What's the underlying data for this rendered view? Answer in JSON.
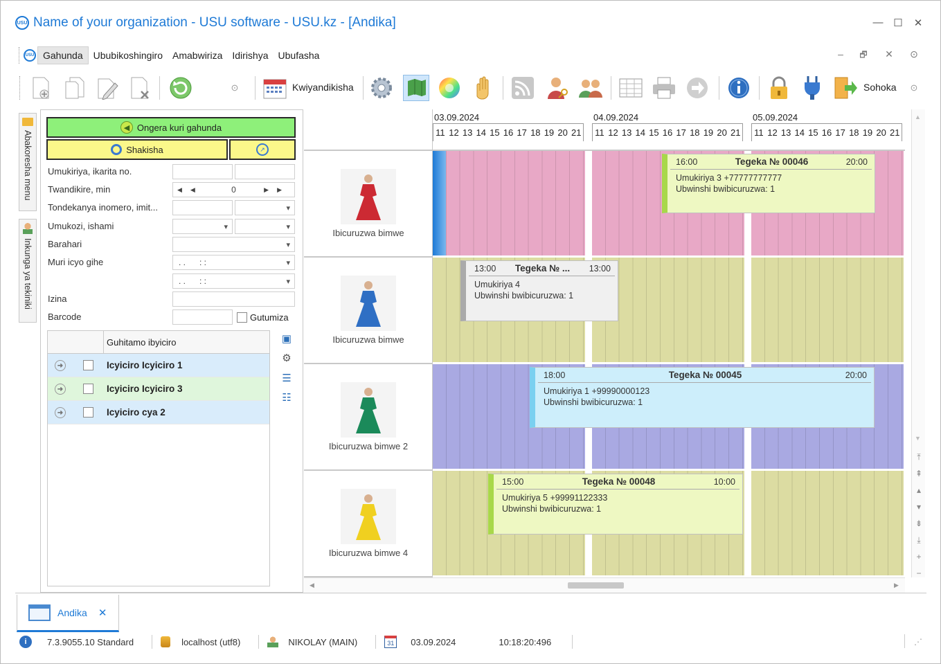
{
  "window": {
    "title": "Name of your organization - USU software - USU.kz - [Andika]",
    "logo_text": "USU",
    "controls": {
      "minimize": "—",
      "maximize": "☐",
      "close": "✕"
    }
  },
  "menu": {
    "items": [
      "Gahunda",
      "Ububikoshingiro",
      "Amabwiriza",
      "Idirishya",
      "Ubufasha"
    ],
    "active_index": 0,
    "mdi_controls": {
      "minimize": "–",
      "restore": "🗗",
      "close": "✕",
      "more": "⊙"
    }
  },
  "toolbar": {
    "kwiyandikisha_label": "Kwiyandikisha",
    "sohoka_label": "Sohoka",
    "icons": [
      "new-doc-icon",
      "copy-icon",
      "edit-icon",
      "delete-icon",
      "refresh-icon",
      "more-icon",
      "calendar-icon",
      "settings-icon",
      "map-icon",
      "color-wheel-icon",
      "hand-icon",
      "rss-icon",
      "user-key-icon",
      "users-icon",
      "grid-icon",
      "print-icon",
      "forward-icon",
      "info-icon",
      "lock-icon",
      "plug-icon",
      "exit-icon"
    ]
  },
  "sidetabs": [
    "Abakoresha menu",
    "Inkunga ya tekiniki"
  ],
  "leftpanel": {
    "add_button": "Ongera kuri gahunda",
    "search_button": "Shakisha",
    "fields": {
      "client_label": "Umukiriya, ikarita no.",
      "duration_label": "Twandikire, min",
      "duration_value": "0",
      "order_label": "Tondekanya inomero, imit...",
      "employee_label": "Umukozi, ishami",
      "email_label": "Barahari",
      "time_label": "Muri icyo gihe",
      "datetime_placeholder": ". .      : :",
      "name_label": "Izina",
      "barcode_label": "Barcode",
      "lock_label": "Gutumiza"
    },
    "tree": {
      "header": "Guhitamo ibyiciro",
      "rows": [
        "Icyiciro Icyiciro 1",
        "Icyiciro Icyiciro 3",
        "Icyiciro cya 2"
      ]
    }
  },
  "schedule": {
    "dates": [
      "03.09.2024",
      "04.09.2024",
      "05.09.2024"
    ],
    "hours": [
      "11",
      "12",
      "13",
      "14",
      "15",
      "16",
      "17",
      "18",
      "19",
      "20",
      "21"
    ],
    "resources": [
      {
        "label": "Ibicuruzwa bimwe",
        "color": "#e8a8c6"
      },
      {
        "label": "Ibicuruzwa bimwe",
        "color": "#dcdca2"
      },
      {
        "label": "Ibicuruzwa bimwe 2",
        "color": "#a9a9e2"
      },
      {
        "label": "Ibicuruzwa bimwe 4",
        "color": "#dcdca2"
      }
    ],
    "bookings": [
      {
        "start": "16:00",
        "title": "Tegeka № 00046",
        "end": "20:00",
        "line1": "Umukiriya 3 +77777777777",
        "line2": "Ubwinshi bwibicuruzwa: 1"
      },
      {
        "start": "13:00",
        "title": "Tegeka № ...",
        "end": "13:00",
        "line1": "Umukiriya 4",
        "line2": "Ubwinshi bwibicuruzwa: 1"
      },
      {
        "start": "18:00",
        "title": "Tegeka № 00045",
        "end": "20:00",
        "line1": "Umukiriya 1 +99990000123",
        "line2": "Ubwinshi bwibicuruzwa: 1"
      },
      {
        "start": "15:00",
        "title": "Tegeka № 00048",
        "end": "10:00",
        "line1": "Umukiriya 5 +99991122333",
        "line2": "Ubwinshi bwibicuruzwa: 1"
      }
    ]
  },
  "tabs": [
    {
      "label": "Andika",
      "close": "✕"
    }
  ],
  "status": {
    "version": "7.3.9055.10 Standard",
    "db": "localhost (utf8)",
    "user": "NIKOLAY (MAIN)",
    "calendar_day": "31",
    "date": "03.09.2024",
    "time": "10:18:20:496"
  }
}
